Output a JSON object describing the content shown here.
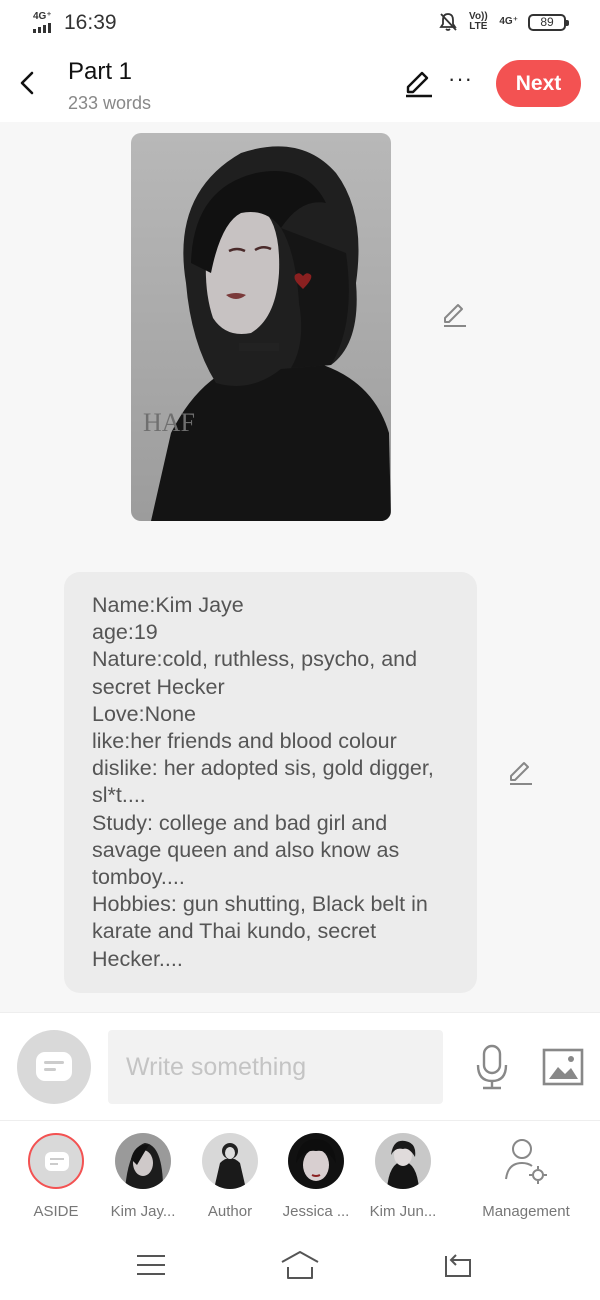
{
  "status_bar": {
    "network": "4G⁺",
    "time": "16:39",
    "volte": "Vo)) LTE",
    "network_right": "4G⁺",
    "battery": "89"
  },
  "header": {
    "title": "Part 1",
    "subtitle": "233 words",
    "next_label": "Next",
    "more_label": "···"
  },
  "story": {
    "cover_watermark": "HAF",
    "text_lines": [
      "Name:Kim Jaye",
      "age:19",
      "Nature:cold, ruthless, psycho, and secret Hecker",
      "Love:None",
      "like:her friends and blood colour",
      "dislike: her adopted sis, gold digger, sl*t....",
      "Study: college and bad girl and savage queen and also know as tomboy....",
      "Hobbies: gun shutting, Black belt in karate and Thai kundo, secret Hecker...."
    ]
  },
  "composer": {
    "placeholder": "Write something"
  },
  "characters": [
    {
      "label": "ASIDE",
      "avatar_icon": "aside-chat-icon"
    },
    {
      "label": "Kim Jay...",
      "avatar_icon": "dark-hair-girl-avatar"
    },
    {
      "label": "Author",
      "avatar_icon": "author-avatar"
    },
    {
      "label": "Jessica ...",
      "avatar_icon": "jessica-avatar"
    },
    {
      "label": "Kim Jun...",
      "avatar_icon": "kim-jun-avatar"
    }
  ],
  "management_label": "Management",
  "colors": {
    "accent": "#f35252",
    "content_bg": "#f7f7f7",
    "card_bg": "#ececec",
    "text_muted": "#888888"
  }
}
